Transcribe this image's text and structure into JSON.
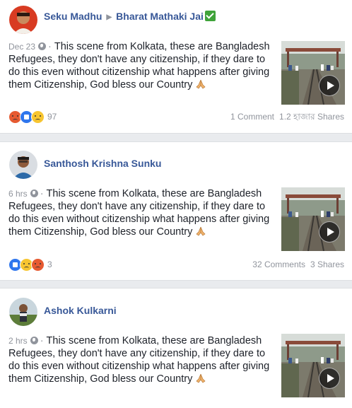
{
  "posts": [
    {
      "author": "Seku Madhu",
      "group": "Bharat Mathaki Jai",
      "time": "Dec 23",
      "text": "This scene from Kolkata, these are Bangladesh Refugees, they don't have any citizenship, if they dare to do this even without citizenship what happens after giving them Citizenship, God bless our Country",
      "reaction_icons": [
        "angry-icon",
        "like-icon",
        "sad-icon"
      ],
      "reaction_count": "97",
      "comments": "1 Comment",
      "shares": "1.2 হাজার Shares"
    },
    {
      "author": "Santhosh Krishna Sunku",
      "time": "6 hrs",
      "text": "This scene from Kolkata, these are Bangladesh Refugees, they don't have any citizenship, if they dare to do this even without citizenship what happens after giving them Citizenship, God bless our Country",
      "reaction_icons": [
        "like-icon",
        "sad-icon",
        "angry-icon"
      ],
      "reaction_count": "3",
      "comments": "32 Comments",
      "shares": "3 Shares"
    },
    {
      "author": "Ashok Kulkarni",
      "time": "2 hrs",
      "text": "This scene from Kolkata, these are Bangladesh Refugees, they don't have any citizenship, if they dare to do this even without citizenship what happens after giving them Citizenship, God bless our Country"
    }
  ],
  "colors": {
    "link": "#385898",
    "meta": "#90949c",
    "background": "#e9ebee",
    "like": "#2f76ed",
    "angry": "#e65a31",
    "sad": "#f7c531"
  }
}
